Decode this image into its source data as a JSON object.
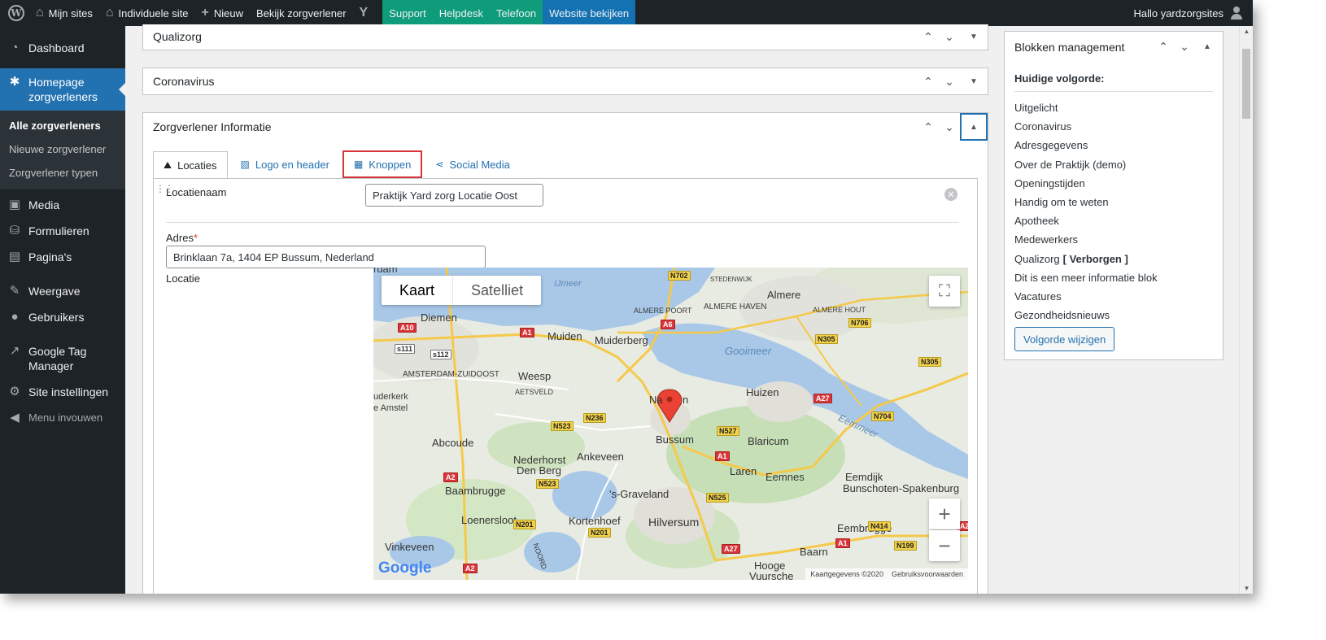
{
  "adminbar": {
    "my_sites": "Mijn sites",
    "individual_site": "Individuele site",
    "new": "Nieuw",
    "view_provider": "Bekijk zorgverlener",
    "support": "Support",
    "helpdesk": "Helpdesk",
    "phone": "Telefoon",
    "view_website": "Website bekijken",
    "greeting": "Hallo yardzorgsites",
    "colors": {
      "bar": "#1d2327",
      "green": "#0f9c7b",
      "blue": "#1472b3"
    }
  },
  "sidebar": {
    "dashboard": "Dashboard",
    "homepage_providers": "Homepage zorgverleners",
    "submenu": [
      "Alle zorgverleners",
      "Nieuwe zorgverlener",
      "Zorgverlener typen"
    ],
    "media": "Media",
    "forms": "Formulieren",
    "pages": "Pagina's",
    "appearance": "Weergave",
    "users": "Gebruikers",
    "gtm": "Google Tag Manager",
    "site_settings": "Site instellingen",
    "collapse": "Menu invouwen"
  },
  "boxes": {
    "qualizorg": "Qualizorg",
    "coronavirus": "Coronavirus",
    "info": "Zorgverlener Informatie"
  },
  "tabs": {
    "locations": "Locaties",
    "logo_header": "Logo en header",
    "buttons": "Knoppen",
    "social_media": "Social Media"
  },
  "location": {
    "name_label": "Locatienaam",
    "name_value": "Praktijk Yard zorg Locatie Oost",
    "address_label": "Adres",
    "required_mark": "*",
    "address_value": "Brinklaan 7a, 1404 EP Bussum, Nederland",
    "location_label": "Locatie"
  },
  "map": {
    "type_map": "Kaart",
    "type_satellite": "Satelliet",
    "zoom_in": "+",
    "zoom_out": "−",
    "google": "Google",
    "attribution": "Kaartgegevens ©2020",
    "terms": "Gebruiksvoorwaarden",
    "labels": {
      "almere": "Almere",
      "almere_haven": "ALMERE HAVEN",
      "almere_poort": "ALMERE POORT",
      "almere_hout": "ALMERE HOUT",
      "stedenwijk": "STEDENWIJK",
      "ijmeer": "IJmeer",
      "diemen": "Diemen",
      "muiden": "Muiden",
      "muiderberg": "Muiderberg",
      "gooimeer": "Gooimeer",
      "amsterdam_zuidoost": "AMSTERDAM-ZUIDOOST",
      "weesp": "Weesp",
      "aetsveld": "AETSVELD",
      "ouderkerk": "uderkerk",
      "amstel": "e Amstel",
      "naarden_a": "Na",
      "naarden_b": "n",
      "huizen": "Huizen",
      "bussum": "Bussum",
      "blaricum": "Blaricum",
      "eemmeer": "Eemmeer",
      "abcoude": "Abcoude",
      "nederhorst": "Nederhorst",
      "den_berg": "Den Berg",
      "ankeveen": "Ankeveen",
      "laren": "Laren",
      "eemnes": "Eemnes",
      "eemdijk": "Eemdijk",
      "bunschoten": "Bunschoten-Spakenburg",
      "baambrugge": "Baambrugge",
      "graveland": "'s-Graveland",
      "loenersloot": "Loenersloot",
      "kortenhoef": "Kortenhoef",
      "hilversum": "Hilversum",
      "eembrugge": "Eembrugge",
      "vinkeveen": "Vinkeveen",
      "baarn": "Baarn",
      "hooge": "Hooge",
      "vuursche": "Vuursche",
      "noord": "NOORD",
      "amsterdam_top": "rdam"
    },
    "roads": [
      "N702",
      "A10",
      "A6",
      "A1",
      "N706",
      "N305",
      "N305",
      "A27",
      "N704",
      "N236",
      "N523",
      "N527",
      "A1",
      "N523",
      "N525",
      "A2",
      "N201",
      "N201",
      "A2",
      "N414",
      "N199",
      "A27",
      "A1",
      "A2",
      "s111",
      "s112"
    ]
  },
  "sidebox": {
    "title": "Blokken management",
    "current_order": "Huidige volgorde:",
    "items": [
      "Uitgelicht",
      "Coronavirus",
      "Adresgegevens",
      "Over de Praktijk (demo)",
      "Openingstijden",
      "Handig om te weten",
      "Apotheek",
      "Medewerkers",
      "Qualizorg",
      "Dit is een meer informatie blok",
      "Vacatures",
      "Gezondheidsnieuws"
    ],
    "hidden_tag": "[ Verborgen ]",
    "change_order": "Volgorde wijzigen"
  }
}
